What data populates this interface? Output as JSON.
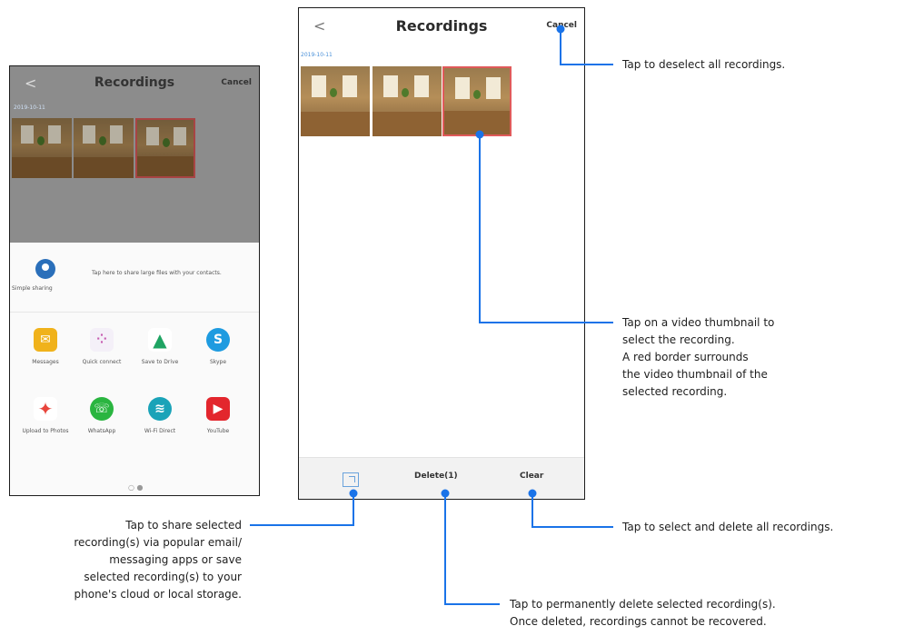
{
  "left_phone": {
    "back": "<",
    "title": "Recordings",
    "cancel": "Cancel",
    "date": "2019-10-11",
    "simple_sharing": {
      "label": "Simple sharing",
      "description": "Tap here to share large files with your contacts."
    },
    "apps": [
      {
        "label": "Messages",
        "icon": "messages-icon",
        "color": "#f0b21b",
        "glyph": "✉"
      },
      {
        "label": "Quick connect",
        "icon": "quick-connect-icon",
        "color": "#f4f0f8",
        "glyph": "⁘"
      },
      {
        "label": "Save to Drive",
        "icon": "drive-icon",
        "color": "#ffffff",
        "glyph": "▲"
      },
      {
        "label": "Skype",
        "icon": "skype-icon",
        "color": "#1e9be0",
        "glyph": "S"
      },
      {
        "label": "Upload to Photos",
        "icon": "photos-icon",
        "color": "#ffffff",
        "glyph": "✦"
      },
      {
        "label": "WhatsApp",
        "icon": "whatsapp-icon",
        "color": "#2ab540",
        "glyph": "☏"
      },
      {
        "label": "Wi-Fi Direct",
        "icon": "wifi-direct-icon",
        "color": "#1aa3b8",
        "glyph": "≋"
      },
      {
        "label": "YouTube",
        "icon": "youtube-icon",
        "color": "#e3262d",
        "glyph": "▶"
      }
    ],
    "page_dots": "○ ●"
  },
  "center_phone": {
    "back": "<",
    "title": "Recordings",
    "cancel": "Cancel",
    "date": "2019-10-11",
    "delete_label": "Delete(1)",
    "clear_label": "Clear"
  },
  "annotations": {
    "cancel_note": "Tap to deselect all recordings.",
    "thumbnail_note": [
      "Tap on a video thumbnail to",
      "select the recording.",
      "A red border surrounds",
      "the video thumbnail of the",
      "selected recording."
    ],
    "clear_note": "Tap to select and delete all recordings.",
    "share_note": [
      "Tap to share selected",
      "recording(s) via popular email/",
      "messaging apps or save",
      "selected recording(s) to your",
      "phone's cloud or local storage."
    ],
    "delete_note": [
      "Tap to permanently delete selected recording(s).",
      "Once deleted, recordings cannot be recovered."
    ]
  },
  "colors": {
    "accent": "#1a73e8",
    "selected_border": "#e05a5a",
    "link_date": "#4a90d9"
  }
}
